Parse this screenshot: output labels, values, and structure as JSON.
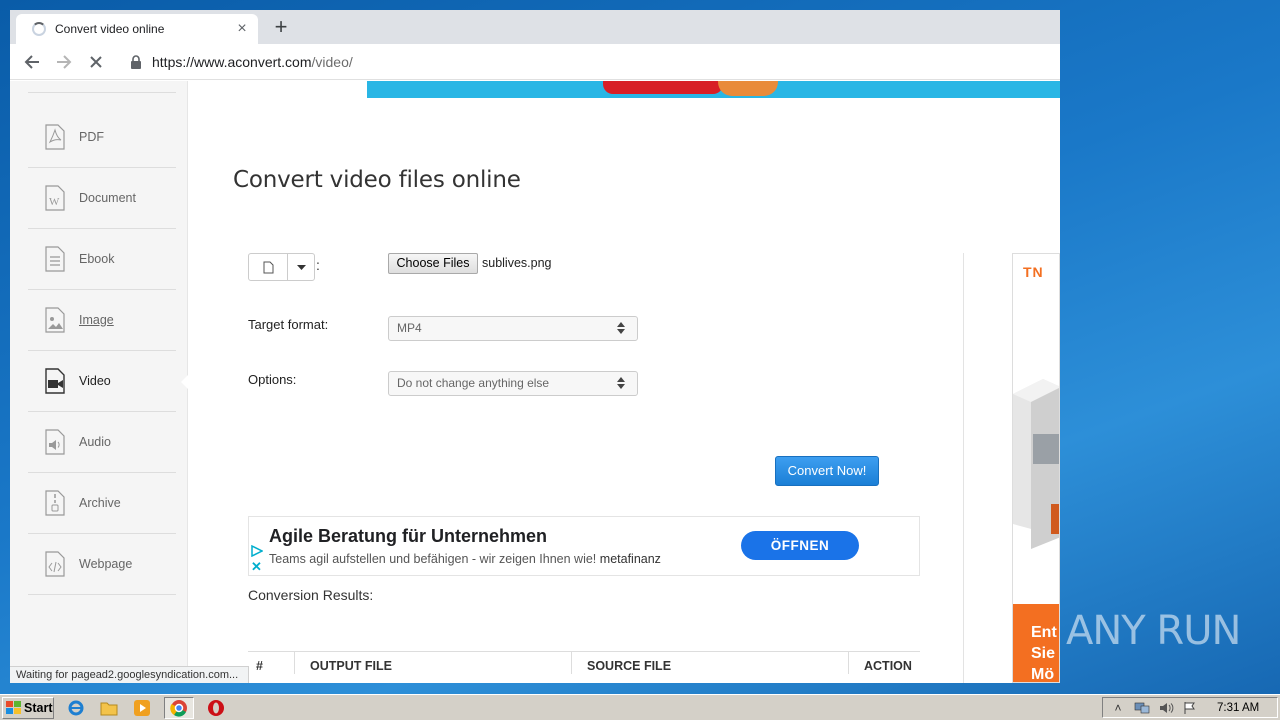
{
  "browser": {
    "tab_title": "Convert video online",
    "url_host": "https://www.aconvert.com",
    "url_path": "/video/",
    "status_text": "Waiting for pagead2.googlesyndication.com..."
  },
  "sidebar": {
    "items": [
      {
        "label": "PDF",
        "icon": "pdf-icon"
      },
      {
        "label": "Document",
        "icon": "word-document-icon"
      },
      {
        "label": "Ebook",
        "icon": "ebook-icon"
      },
      {
        "label": "Image",
        "icon": "image-icon"
      },
      {
        "label": "Video",
        "icon": "video-camera-icon"
      },
      {
        "label": "Audio",
        "icon": "audio-icon"
      },
      {
        "label": "Archive",
        "icon": "archive-icon"
      },
      {
        "label": "Webpage",
        "icon": "webpage-icon"
      }
    ],
    "active_item": "Video"
  },
  "main": {
    "title": "Convert video files online",
    "source_colon": ":",
    "choose_files_label": "Choose Files",
    "selected_file": "sublives.png",
    "target_format_label": "Target format:",
    "target_format_value": "MP4",
    "options_label": "Options:",
    "options_value": "Do not change anything else",
    "convert_button": "Convert Now!",
    "results_title": "Conversion Results:",
    "results_columns": [
      "#",
      "OUTPUT FILE",
      "SOURCE FILE",
      "ACTION"
    ]
  },
  "ad": {
    "headline": "Agile Beratung für Unternehmen",
    "description": "Teams agil aufstellen und befähigen - wir zeigen Ihnen wie!",
    "advertiser": "metafinanz",
    "button": "ÖFFNEN"
  },
  "side_ad": {
    "logo": "TN",
    "text_lines": [
      "Ent",
      "Sie",
      "Mö"
    ]
  },
  "watermark": {
    "text": "ANY RUN"
  },
  "taskbar": {
    "start_label": "Start",
    "clock": "7:31 AM"
  },
  "colors": {
    "accent_blue": "#1b7fd6",
    "ad_button": "#1a73e8",
    "desktop": "#1a78c8"
  }
}
